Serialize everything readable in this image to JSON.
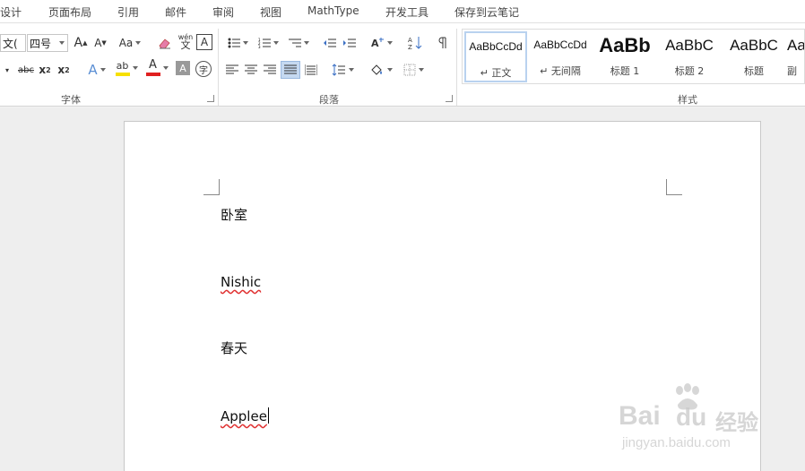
{
  "menubar": {
    "items": [
      "设计",
      "页面布局",
      "引用",
      "邮件",
      "审阅",
      "视图",
      "MathType",
      "开发工具",
      "保存到云笔记"
    ]
  },
  "ribbon": {
    "font_group": {
      "label": "字体",
      "font_name": "文(",
      "font_size": "四号",
      "grow_icon": "A",
      "shrink_icon": "A",
      "change_case_label": "Aa",
      "phonetic_top": "wén",
      "phonetic_bottom": "文",
      "border_char": "A",
      "strike_label": "abc",
      "subscript_label": "x",
      "subscript_sub": "2",
      "superscript_label": "x",
      "superscript_sup": "2",
      "text_effect_label": "A",
      "highlight_label": "ab",
      "font_color_label": "A",
      "shade_label": "A",
      "enclose_label": "字"
    },
    "paragraph_group": {
      "label": "段落"
    },
    "styles_group": {
      "label": "样式",
      "tiles": [
        {
          "sample": "AaBbCcDd",
          "name": "↵ 正文"
        },
        {
          "sample": "AaBbCcDd",
          "name": "↵ 无间隔"
        },
        {
          "sample": "AaBb",
          "name": "标题 1"
        },
        {
          "sample": "AaBbC",
          "name": "标题 2"
        },
        {
          "sample": "AaBbC",
          "name": "标题"
        },
        {
          "sample": "Aa",
          "name": "副"
        }
      ]
    },
    "colors": {
      "highlight": "#f7e000",
      "font_red": "#e02020",
      "selected_bg": "#c5d9f1"
    }
  },
  "document": {
    "paragraphs": [
      "卧室",
      "Nishic",
      "春天",
      "Applee"
    ]
  },
  "watermark": {
    "brand": "Bai",
    "brand2": "du",
    "suffix": "经验",
    "url": "jingyan.baidu.com"
  }
}
